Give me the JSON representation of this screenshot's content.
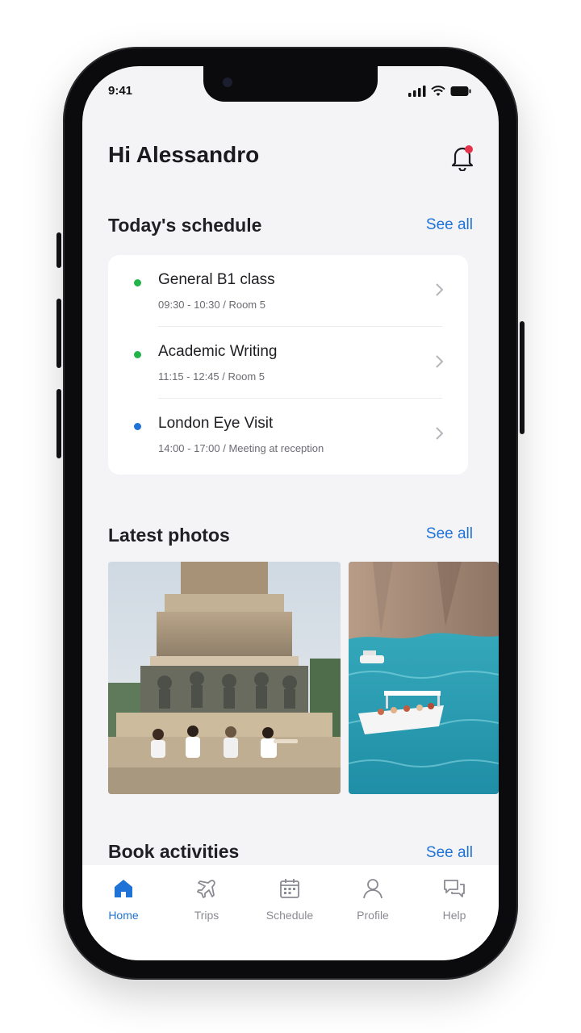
{
  "status_bar": {
    "time": "9:41"
  },
  "header": {
    "greeting": "Hi Alessandro"
  },
  "schedule": {
    "title": "Today's schedule",
    "see_all": "See all",
    "items": [
      {
        "title": "General B1 class",
        "subtitle": "09:30 - 10:30 / Room 5",
        "dot_color": "#22b34a"
      },
      {
        "title": "Academic Writing",
        "subtitle": "11:15 - 12:45 / Room 5",
        "dot_color": "#22b34a"
      },
      {
        "title": "London Eye Visit",
        "subtitle": "14:00 - 17:00 / Meeting at reception",
        "dot_color": "#1f73d6"
      }
    ]
  },
  "photos": {
    "title": "Latest photos",
    "see_all": "See all"
  },
  "activities": {
    "title": "Book activities",
    "see_all": "See all"
  },
  "nav": {
    "items": [
      {
        "label": "Home",
        "icon": "home-icon",
        "active": true
      },
      {
        "label": "Trips",
        "icon": "plane-icon",
        "active": false
      },
      {
        "label": "Schedule",
        "icon": "calendar-icon",
        "active": false
      },
      {
        "label": "Profile",
        "icon": "user-icon",
        "active": false
      },
      {
        "label": "Help",
        "icon": "chat-icon",
        "active": false
      }
    ]
  },
  "colors": {
    "accent": "#1f73d6",
    "notification_badge": "#e5334b"
  }
}
